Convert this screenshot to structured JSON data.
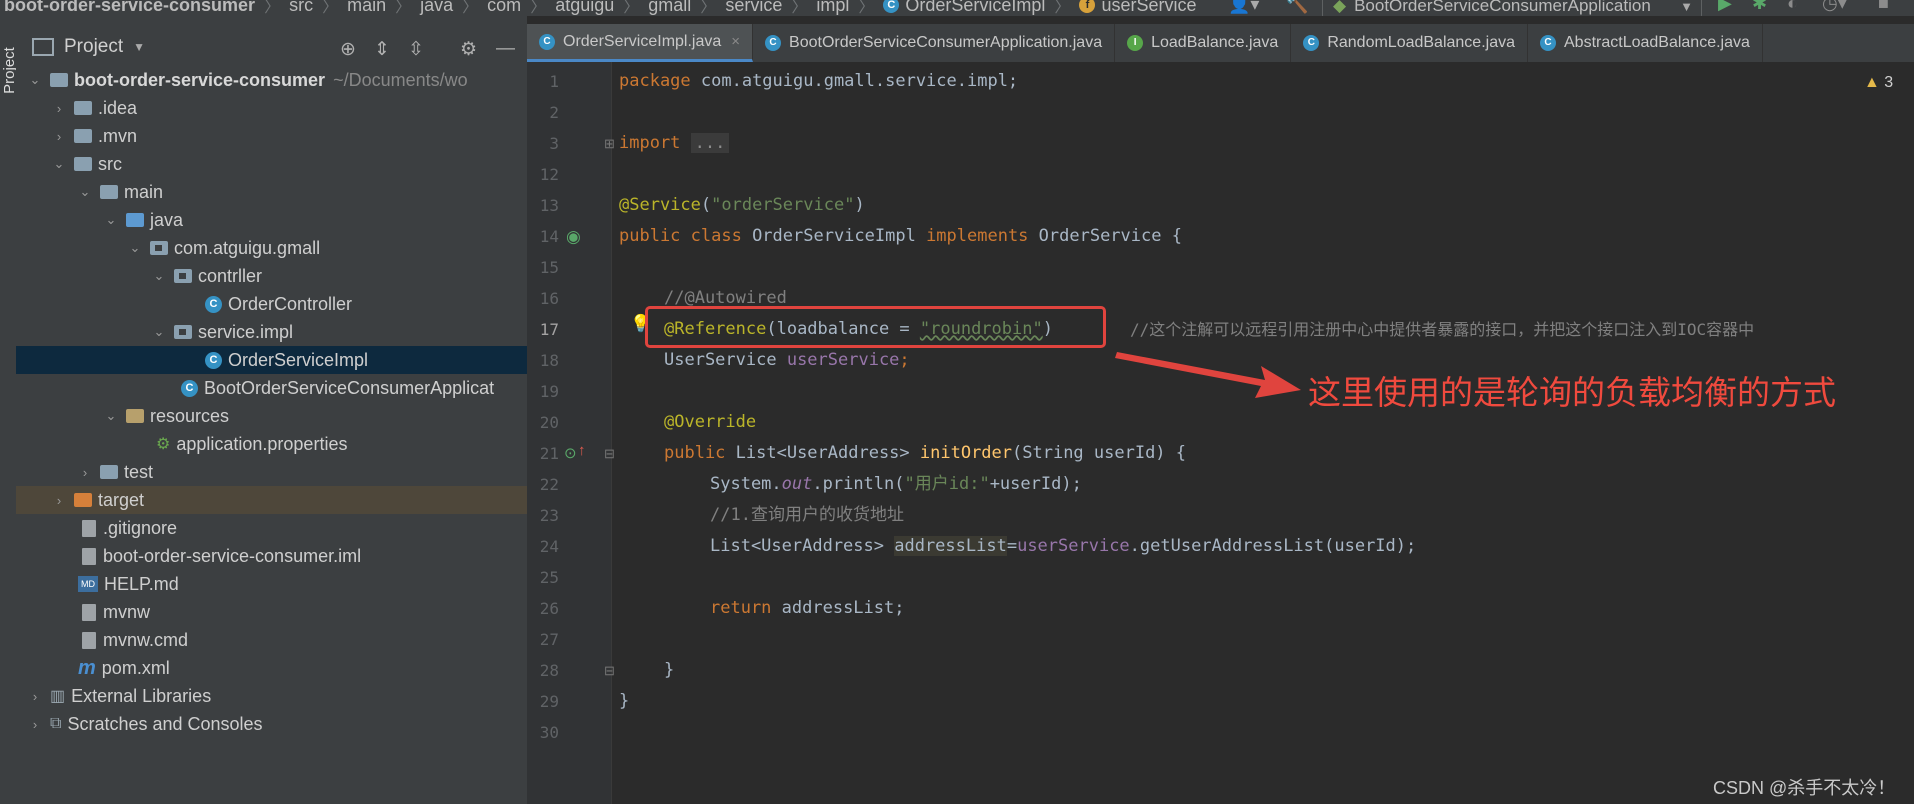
{
  "breadcrumb": [
    "boot-order-service-consumer",
    "src",
    "main",
    "java",
    "com",
    "atguigu",
    "gmall",
    "service",
    "impl",
    "OrderServiceImpl",
    "userService"
  ],
  "run_config": "BootOrderServiceConsumerApplication",
  "sidebar_strip_label": "Project",
  "project_panel": {
    "title": "Project",
    "tree": [
      {
        "label": "boot-order-service-consumer",
        "suffix": "~/Documents/wo",
        "icon": "module-folder-icon"
      },
      {
        "label": ".idea",
        "icon": "folder-icon"
      },
      {
        "label": ".mvn",
        "icon": "folder-icon"
      },
      {
        "label": "src",
        "icon": "folder-icon"
      },
      {
        "label": "main",
        "icon": "folder-icon"
      },
      {
        "label": "java",
        "icon": "source-folder-icon"
      },
      {
        "label": "com.atguigu.gmall",
        "icon": "package-icon"
      },
      {
        "label": "contrller",
        "icon": "package-icon"
      },
      {
        "label": "OrderController",
        "icon": "class-icon"
      },
      {
        "label": "service.impl",
        "icon": "package-icon"
      },
      {
        "label": "OrderServiceImpl",
        "icon": "class-icon"
      },
      {
        "label": "BootOrderServiceConsumerApplicat",
        "icon": "spring-class-icon"
      },
      {
        "label": "resources",
        "icon": "resources-folder-icon"
      },
      {
        "label": "application.properties",
        "icon": "properties-icon"
      },
      {
        "label": "test",
        "icon": "folder-icon"
      },
      {
        "label": "target",
        "icon": "excluded-folder-icon"
      },
      {
        "label": ".gitignore",
        "icon": "file-icon"
      },
      {
        "label": "boot-order-service-consumer.iml",
        "icon": "file-icon"
      },
      {
        "label": "HELP.md",
        "icon": "markdown-icon"
      },
      {
        "label": "mvnw",
        "icon": "file-icon"
      },
      {
        "label": "mvnw.cmd",
        "icon": "file-icon"
      },
      {
        "label": "pom.xml",
        "icon": "maven-icon"
      },
      {
        "label": "External Libraries",
        "icon": "library-icon"
      },
      {
        "label": "Scratches and Consoles",
        "icon": "scratches-icon"
      }
    ]
  },
  "tabs": [
    {
      "label": "OrderServiceImpl.java",
      "active": true
    },
    {
      "label": "BootOrderServiceConsumerApplication.java"
    },
    {
      "label": "LoadBalance.java"
    },
    {
      "label": "RandomLoadBalance.java"
    },
    {
      "label": "AbstractLoadBalance.java"
    }
  ],
  "line_numbers": [
    "1",
    "2",
    "3",
    "12",
    "13",
    "14",
    "15",
    "16",
    "17",
    "18",
    "19",
    "20",
    "21",
    "22",
    "23",
    "24",
    "25",
    "26",
    "27",
    "28",
    "29",
    "30"
  ],
  "code": {
    "l1_kw": "package",
    "l1_rest": " com.atguigu.gmall.service.impl;",
    "l3_kw": "import",
    "l3_fold": "...",
    "l13_an": "@Service",
    "l13_p1": "(",
    "l13_st": "\"orderService\"",
    "l13_p2": ")",
    "l14_kw1": "public class",
    "l14_name": " OrderServiceImpl ",
    "l14_kw2": "implements",
    "l14_rest": " OrderService {",
    "l16_cm": "//@Autowired",
    "l17_an": "@Reference",
    "l17_p1": "(loadbalance = ",
    "l17_st": "\"roundrobin\"",
    "l17_p2": ")",
    "l17_cm": "//这个注解可以远程引用注册中心中提供者暴露的接口，并把这个接口注入到IOC容器中",
    "l18_type": "UserService ",
    "l18_fld": "userService",
    "l18_semi": ";",
    "l20_an": "@Override",
    "l21_kw": "public",
    "l21_t": " List<UserAddress> ",
    "l21_fn": "initOrder",
    "l21_rest": "(String userId) {",
    "l22_a": "System.",
    "l22_it": "out",
    "l22_b": ".println(",
    "l22_st": "\"用户id:\"",
    "l22_c": "+userId);",
    "l23_cm": "//1.查询用户的收货地址",
    "l24_a": "List<UserAddress> ",
    "l24_hl": "addressList",
    "l24_b": "=",
    "l24_fld": "userService",
    "l24_c": ".getUserAddressList(userId);",
    "l26_kw": "return",
    "l26_rest": " addressList;",
    "l28": "}",
    "l29": "}"
  },
  "inspection_count": "3",
  "annotation_text": "这里使用的是轮询的负载均衡的方式",
  "watermark": "CSDN @杀手不太冷！",
  "colors": {
    "annotation_red": "#e0443e",
    "keyword": "#cc7832",
    "annotation": "#bbb529",
    "string": "#6a8759"
  }
}
